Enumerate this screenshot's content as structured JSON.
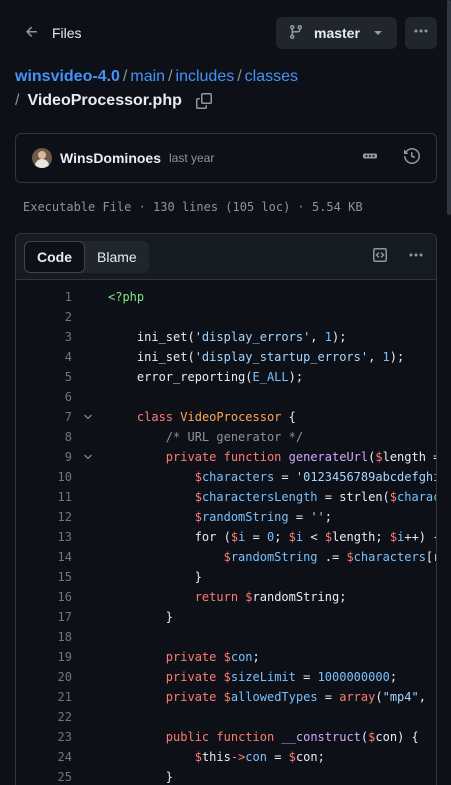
{
  "topbar": {
    "files_label": "Files",
    "branch": "master"
  },
  "breadcrumb": {
    "repo": "winsvideo-4.0",
    "parts": [
      "main",
      "includes",
      "classes"
    ],
    "filename": "VideoProcessor.php",
    "sep": "/"
  },
  "commit": {
    "author": "WinsDominoes",
    "time": "last year"
  },
  "fileinfo": "Executable File · 130 lines (105 loc) · 5.54 KB",
  "code_tabs": [
    "Code",
    "Blame"
  ],
  "colors": {
    "keyword": "#ff7b72",
    "string": "#a5d6ff",
    "variable": "#ffa657",
    "function": "#d2a8ff",
    "constant": "#79c0ff",
    "comment": "#8b949e",
    "link": "#4493f8"
  },
  "lines": [
    {
      "n": "1",
      "fold": false,
      "tokens": [
        [
          "<?php",
          "tag"
        ]
      ]
    },
    {
      "n": "2",
      "fold": false,
      "tokens": []
    },
    {
      "n": "3",
      "fold": false,
      "tokens": [
        [
          "    ini_set(",
          ""
        ],
        [
          "'display_errors'",
          "str"
        ],
        [
          ", ",
          ""
        ],
        [
          "1",
          "const"
        ],
        [
          ");",
          ""
        ]
      ]
    },
    {
      "n": "4",
      "fold": false,
      "tokens": [
        [
          "    ini_set(",
          ""
        ],
        [
          "'display_startup_errors'",
          "str"
        ],
        [
          ", ",
          ""
        ],
        [
          "1",
          "const"
        ],
        [
          ");",
          ""
        ]
      ]
    },
    {
      "n": "5",
      "fold": false,
      "tokens": [
        [
          "    error_reporting(",
          ""
        ],
        [
          "E_ALL",
          "const"
        ],
        [
          ");",
          ""
        ]
      ]
    },
    {
      "n": "6",
      "fold": false,
      "tokens": []
    },
    {
      "n": "7",
      "fold": true,
      "tokens": [
        [
          "    ",
          ""
        ],
        [
          "class",
          "kw"
        ],
        [
          " ",
          ""
        ],
        [
          "VideoProcessor",
          "var"
        ],
        [
          " {",
          ""
        ]
      ]
    },
    {
      "n": "8",
      "fold": false,
      "tokens": [
        [
          "        ",
          ""
        ],
        [
          "/* URL generator */",
          "cm"
        ]
      ]
    },
    {
      "n": "9",
      "fold": true,
      "tokens": [
        [
          "        ",
          ""
        ],
        [
          "private",
          "kw"
        ],
        [
          " ",
          ""
        ],
        [
          "function",
          "kw"
        ],
        [
          " ",
          ""
        ],
        [
          "generateUrl",
          "fn"
        ],
        [
          "(",
          ""
        ],
        [
          "$",
          "kw"
        ],
        [
          "length",
          ""
        ],
        [
          " = ",
          ""
        ]
      ]
    },
    {
      "n": "10",
      "fold": false,
      "tokens": [
        [
          "            ",
          ""
        ],
        [
          "$",
          "kw"
        ],
        [
          "characters",
          "const"
        ],
        [
          " = ",
          ""
        ],
        [
          "'0123456789abcdefghi",
          "str"
        ]
      ]
    },
    {
      "n": "11",
      "fold": false,
      "tokens": [
        [
          "            ",
          ""
        ],
        [
          "$",
          "kw"
        ],
        [
          "charactersLength",
          "const"
        ],
        [
          " = strlen(",
          ""
        ],
        [
          "$",
          "kw"
        ],
        [
          "charac",
          "const"
        ]
      ]
    },
    {
      "n": "12",
      "fold": false,
      "tokens": [
        [
          "            ",
          ""
        ],
        [
          "$",
          "kw"
        ],
        [
          "randomString",
          "const"
        ],
        [
          " = ",
          ""
        ],
        [
          "''",
          "str"
        ],
        [
          ";",
          ""
        ]
      ]
    },
    {
      "n": "13",
      "fold": false,
      "tokens": [
        [
          "            for (",
          ""
        ],
        [
          "$",
          "kw"
        ],
        [
          "i",
          "const"
        ],
        [
          " = ",
          ""
        ],
        [
          "0",
          "const"
        ],
        [
          "; ",
          ""
        ],
        [
          "$",
          "kw"
        ],
        [
          "i",
          "const"
        ],
        [
          " < ",
          ""
        ],
        [
          "$",
          "kw"
        ],
        [
          "length",
          ""
        ],
        [
          "; ",
          ""
        ],
        [
          "$",
          "kw"
        ],
        [
          "i",
          "const"
        ],
        [
          "++) {",
          ""
        ]
      ]
    },
    {
      "n": "14",
      "fold": false,
      "tokens": [
        [
          "                ",
          ""
        ],
        [
          "$",
          "kw"
        ],
        [
          "randomString",
          "const"
        ],
        [
          " .= ",
          ""
        ],
        [
          "$",
          "kw"
        ],
        [
          "characters",
          "const"
        ],
        [
          "[r",
          ""
        ]
      ]
    },
    {
      "n": "15",
      "fold": false,
      "tokens": [
        [
          "            }",
          ""
        ]
      ]
    },
    {
      "n": "16",
      "fold": false,
      "tokens": [
        [
          "            ",
          ""
        ],
        [
          "return",
          "kw"
        ],
        [
          " ",
          ""
        ],
        [
          "$",
          "kw"
        ],
        [
          "randomString",
          ""
        ],
        [
          ";",
          ""
        ]
      ]
    },
    {
      "n": "17",
      "fold": false,
      "tokens": [
        [
          "        }",
          ""
        ]
      ]
    },
    {
      "n": "18",
      "fold": false,
      "tokens": []
    },
    {
      "n": "19",
      "fold": false,
      "tokens": [
        [
          "        ",
          ""
        ],
        [
          "private",
          "kw"
        ],
        [
          " ",
          ""
        ],
        [
          "$",
          "kw"
        ],
        [
          "con",
          "const"
        ],
        [
          ";",
          ""
        ]
      ]
    },
    {
      "n": "20",
      "fold": false,
      "tokens": [
        [
          "        ",
          ""
        ],
        [
          "private",
          "kw"
        ],
        [
          " ",
          ""
        ],
        [
          "$",
          "kw"
        ],
        [
          "sizeLimit",
          "const"
        ],
        [
          " = ",
          ""
        ],
        [
          "1000000000",
          "const"
        ],
        [
          ";",
          ""
        ]
      ]
    },
    {
      "n": "21",
      "fold": false,
      "tokens": [
        [
          "        ",
          ""
        ],
        [
          "private",
          "kw"
        ],
        [
          " ",
          ""
        ],
        [
          "$",
          "kw"
        ],
        [
          "allowedTypes",
          "const"
        ],
        [
          " = ",
          ""
        ],
        [
          "array",
          "kw"
        ],
        [
          "(",
          ""
        ],
        [
          "\"mp4\"",
          "str"
        ],
        [
          ", ",
          ""
        ],
        [
          "'",
          "str"
        ]
      ]
    },
    {
      "n": "22",
      "fold": false,
      "tokens": []
    },
    {
      "n": "23",
      "fold": false,
      "tokens": [
        [
          "        ",
          ""
        ],
        [
          "public",
          "kw"
        ],
        [
          " ",
          ""
        ],
        [
          "function",
          "kw"
        ],
        [
          " ",
          ""
        ],
        [
          "__construct",
          "fn"
        ],
        [
          "(",
          ""
        ],
        [
          "$",
          "kw"
        ],
        [
          "con",
          ""
        ],
        [
          ") {",
          ""
        ]
      ]
    },
    {
      "n": "24",
      "fold": false,
      "tokens": [
        [
          "            ",
          ""
        ],
        [
          "$",
          "kw"
        ],
        [
          "this",
          ""
        ],
        [
          "->",
          "kw"
        ],
        [
          "con",
          "const"
        ],
        [
          " = ",
          ""
        ],
        [
          "$",
          "kw"
        ],
        [
          "con",
          ""
        ],
        [
          ";",
          ""
        ]
      ]
    },
    {
      "n": "25",
      "fold": false,
      "tokens": [
        [
          "        }",
          ""
        ]
      ]
    }
  ]
}
